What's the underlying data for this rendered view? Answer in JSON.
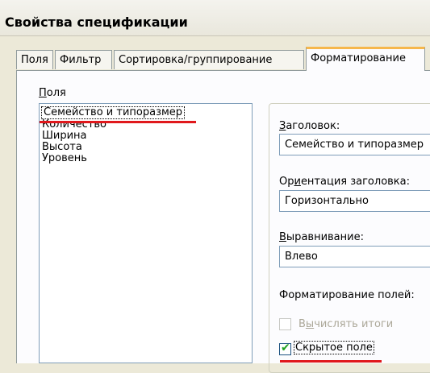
{
  "window": {
    "title": "Свойства спецификации"
  },
  "tabs": [
    {
      "label": "Поля"
    },
    {
      "label": "Фильтр"
    },
    {
      "label": "Сортировка/группирование"
    },
    {
      "label": "Форматирование"
    }
  ],
  "fields_label": "Поля",
  "fields_list": [
    "Семейство и типоразмер",
    "Количество",
    "Ширина",
    "Высота",
    "Уровень"
  ],
  "format": {
    "heading_label": "Заголовок:",
    "heading_value": "Семейство и типоразмер",
    "orientation_label": "Ориентация заголовка:",
    "orientation_value": "Горизонтально",
    "alignment_label": "Выравнивание:",
    "alignment_value": "Влево",
    "field_format_label": "Форматирование полей:",
    "calc_totals_label": "Вычислять итоги",
    "calc_totals_checked": false,
    "hidden_field_label": "Скрытое поле",
    "hidden_field_checked": true
  },
  "colors": {
    "annotation_red": "#e0181c",
    "active_tab_accent": "#f6b74b"
  }
}
